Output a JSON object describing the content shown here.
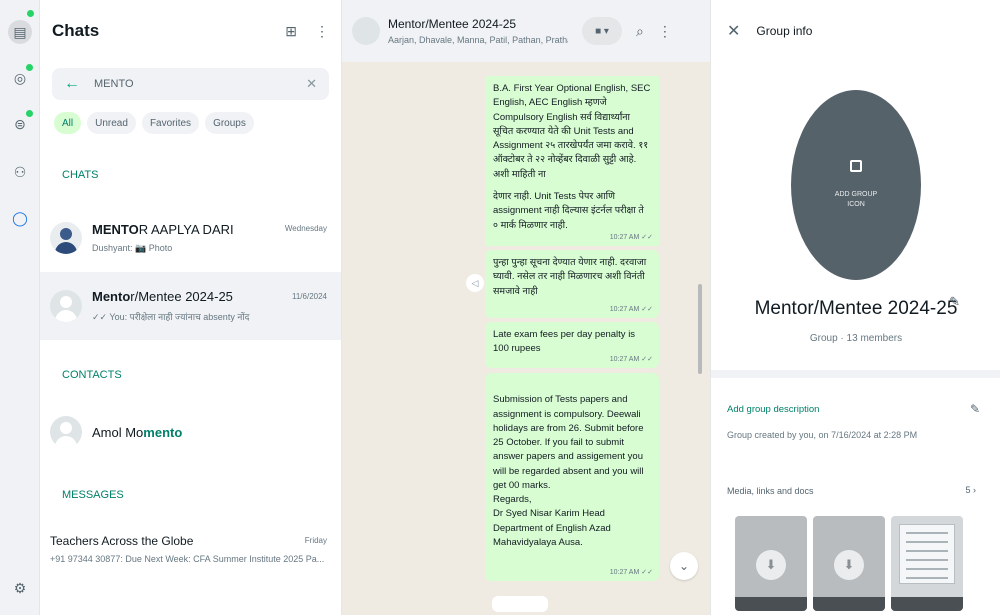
{
  "rail": {
    "icons": [
      "chats-icon",
      "status-icon",
      "channels-icon",
      "communities-icon",
      "meta-ai-icon",
      "settings-icon"
    ]
  },
  "chat_list": {
    "title": "Chats",
    "search_value": "MENTO",
    "filters": [
      "All",
      "Unread",
      "Favorites",
      "Groups"
    ],
    "section_chats": "CHATS",
    "chats": [
      {
        "name_bold": "MENTO",
        "name_rest": "R AAPLYA DARI",
        "preview": "Dushyant: 📷 Photo",
        "time": "Wednesday"
      },
      {
        "name_bold": "Mento",
        "name_rest": "r/Mentee 2024-25",
        "preview": "✓✓ You: परीक्षेला नाही ज्यांनाच absenty नोंद",
        "time": "11/6/2024"
      }
    ],
    "section_contacts": "CONTACTS",
    "contact": {
      "name_plain": "Amol Mo",
      "name_bold": "mento"
    },
    "section_messages": "MESSAGES",
    "message_result": {
      "name": "Teachers Across the Globe",
      "preview": "+91 97344 30877: Due Next Week: CFA Summer Institute 2025 Pa...",
      "time": "Friday"
    }
  },
  "conversation": {
    "group_name": "Mentor/Mentee 2024-25",
    "members": "Aarjan, Dhavale, Manna, Patil, Pathan, Pratham...",
    "messages": [
      {
        "text": "B.A. First Year Optional English, SEC English, AEC English म्हणजे Compulsory English सर्व विद्यार्थ्यांना सूचित करण्यात येते की Unit Tests and Assignment २५ तारखेपर्यंत जमा करावे. ११ ऑक्टोबर ते २२ नोव्हेंबर दिवाळी सुट्टी आहे. अशी माहिती ना",
        "time": ""
      },
      {
        "text": "देणार नाही. Unit Tests पेपर आणि assignment नाही दिल्यास इंटर्नल परीक्षा ते ० मार्क मिळणार नाही.",
        "time": "10:27 AM ✓✓"
      },
      {
        "text": "पुन्हा पुन्हा सूचना देण्यात येणार नाही. दरवाजा घ्यावी. नसेल तर नाही मिळणारच अशी विनंती समजावे नाही",
        "time": "10:27 AM ✓✓"
      },
      {
        "text": "Late exam fees per day penalty is 100 rupees",
        "time": "10:27 AM ✓✓"
      },
      {
        "text": "Submission of Tests papers and assignment is compulsory. Deewali holidays are from 26. Submit before 25 October. If you fail to submit answer papers and assigement you will be regarded absent and you will get 00 marks.\nRegards,\nDr Syed Nisar Karim Head Department of English Azad Mahavidyalaya Ausa.",
        "time": "10:27 AM ✓✓"
      }
    ]
  },
  "group_info": {
    "header": "Group info",
    "add_icon_label": "ADD GROUP ICON",
    "name": "Mentor/Mentee 2024-25",
    "subtitle": "Group · 13 members",
    "add_description": "Add group description",
    "created": "Group created by you, on 7/16/2024 at 2:28 PM",
    "media_label": "Media, links and docs",
    "media_count": "5 ›"
  },
  "colors": {
    "accent": "#00a884",
    "bubble_out": "#d9fdd3",
    "chat_bg": "#efeae2",
    "panel_bg": "#f0f2f5"
  }
}
